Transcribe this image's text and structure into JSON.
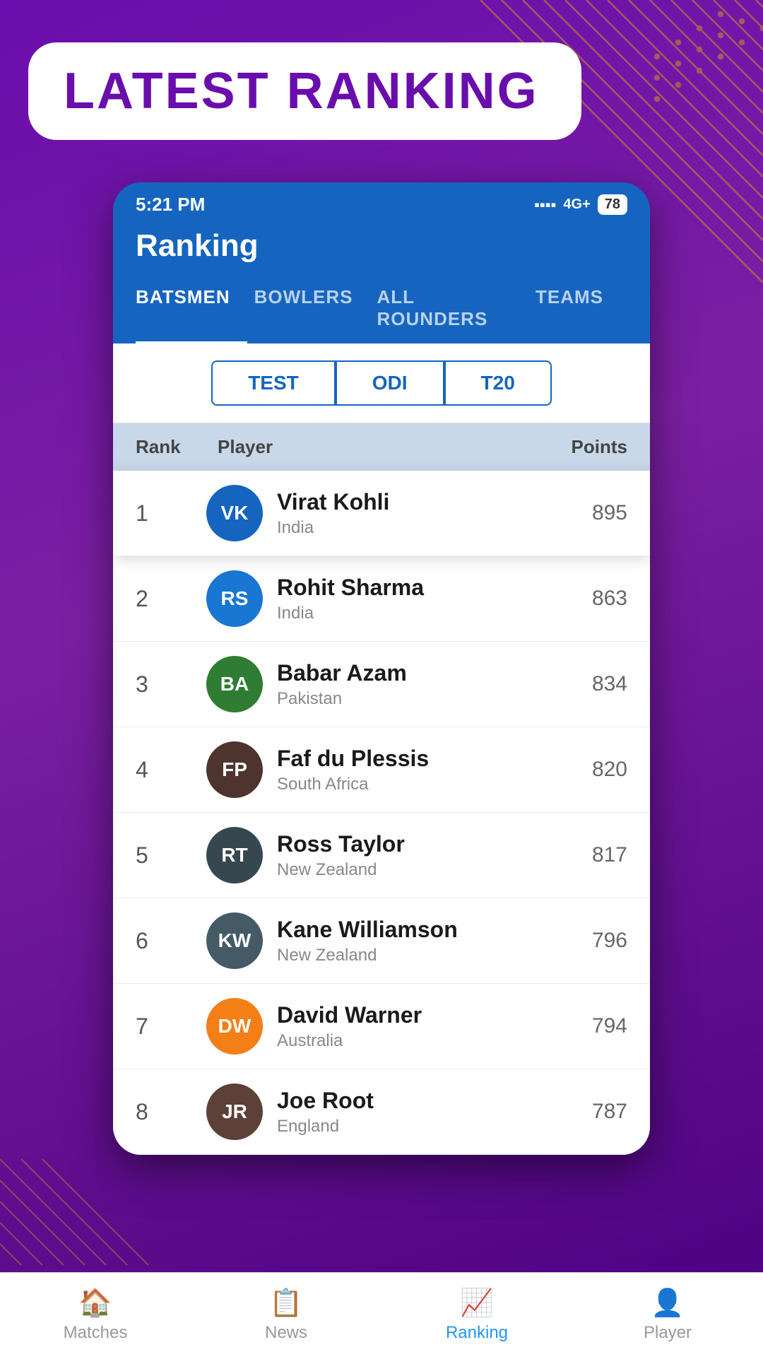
{
  "app": {
    "title": "Latest Ranking",
    "statusBar": {
      "time": "5:21 PM",
      "signal": "4G+",
      "battery": "78"
    }
  },
  "header": {
    "title": "Ranking",
    "tabs": [
      {
        "id": "batsmen",
        "label": "BATSMEN",
        "active": true
      },
      {
        "id": "bowlers",
        "label": "BOWLERS",
        "active": false
      },
      {
        "id": "allrounders",
        "label": "ALL ROUNDERS",
        "active": false
      },
      {
        "id": "teams",
        "label": "TEAMS",
        "active": false
      }
    ]
  },
  "formatSelector": {
    "options": [
      {
        "id": "test",
        "label": "TEST",
        "active": false
      },
      {
        "id": "odi",
        "label": "ODI",
        "active": false
      },
      {
        "id": "t20",
        "label": "T20",
        "active": true
      }
    ]
  },
  "table": {
    "columns": {
      "rank": "Rank",
      "player": "Player",
      "points": "Points"
    },
    "players": [
      {
        "rank": 1,
        "name": "Virat Kohli",
        "country": "India",
        "points": 895,
        "highlighted": true,
        "initials": "VK",
        "avatarClass": "av-1"
      },
      {
        "rank": 2,
        "name": "Rohit Sharma",
        "country": "India",
        "points": 863,
        "highlighted": false,
        "initials": "RS",
        "avatarClass": "av-2"
      },
      {
        "rank": 3,
        "name": "Babar Azam",
        "country": "Pakistan",
        "points": 834,
        "highlighted": false,
        "initials": "BA",
        "avatarClass": "av-3"
      },
      {
        "rank": 4,
        "name": "Faf du Plessis",
        "country": "South Africa",
        "points": 820,
        "highlighted": false,
        "initials": "FP",
        "avatarClass": "av-4"
      },
      {
        "rank": 5,
        "name": "Ross Taylor",
        "country": "New Zealand",
        "points": 817,
        "highlighted": false,
        "initials": "RT",
        "avatarClass": "av-5"
      },
      {
        "rank": 6,
        "name": "Kane Williamson",
        "country": "New Zealand",
        "points": 796,
        "highlighted": false,
        "initials": "KW",
        "avatarClass": "av-6"
      },
      {
        "rank": 7,
        "name": "David Warner",
        "country": "Australia",
        "points": 794,
        "highlighted": false,
        "initials": "DW",
        "avatarClass": "av-7"
      },
      {
        "rank": 8,
        "name": "Joe Root",
        "country": "England",
        "points": 787,
        "highlighted": false,
        "initials": "JR",
        "avatarClass": "av-8"
      }
    ]
  },
  "bottomNav": [
    {
      "id": "matches",
      "label": "Matches",
      "icon": "🏠",
      "active": false
    },
    {
      "id": "news",
      "label": "News",
      "icon": "📋",
      "active": false
    },
    {
      "id": "ranking",
      "label": "Ranking",
      "icon": "📈",
      "active": true
    },
    {
      "id": "player",
      "label": "Player",
      "icon": "👤",
      "active": false
    }
  ]
}
